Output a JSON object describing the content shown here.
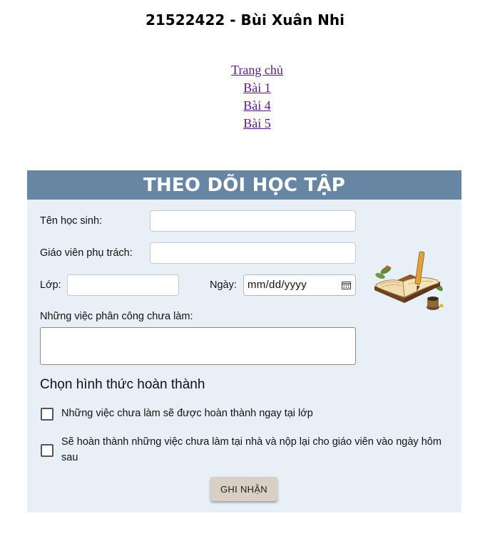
{
  "header": {
    "title": "21522422 - Bùi Xuân Nhi"
  },
  "nav": {
    "links": [
      "Trang chủ",
      "Bài 1",
      "Bài 4",
      "Bài 5"
    ]
  },
  "form": {
    "title": "THEO DÕI HỌC TẬP",
    "student_name_label": "Tên học sinh:",
    "student_name_value": "",
    "teacher_label": "Giáo viên phụ trách:",
    "teacher_value": "",
    "class_label": "Lớp:",
    "class_value": "",
    "date_label": "Ngày:",
    "date_placeholder": "mm/dd/yyyy",
    "tasks_label": "Những việc phân công chưa làm:",
    "tasks_value": "",
    "completion_heading": "Chọn hình thức hoàn thành",
    "options": [
      {
        "label": "Những việc chưa làm sẽ được hoàn thành ngay tại lớp",
        "checked": false
      },
      {
        "label": "Sẽ hoàn thành những việc chưa làm tại nhà và nộp lại cho giáo viên vào ngày hôm sau",
        "checked": false
      }
    ],
    "submit_label": "GHI NHẬN"
  },
  "colors": {
    "card_header": "#6786a3",
    "card_background": "#e9eff7",
    "submit_button": "#d9cfc4",
    "link": "#551a8b"
  },
  "icons": {
    "calendar": "calendar-icon",
    "illustration": "book-quill-illustration"
  }
}
